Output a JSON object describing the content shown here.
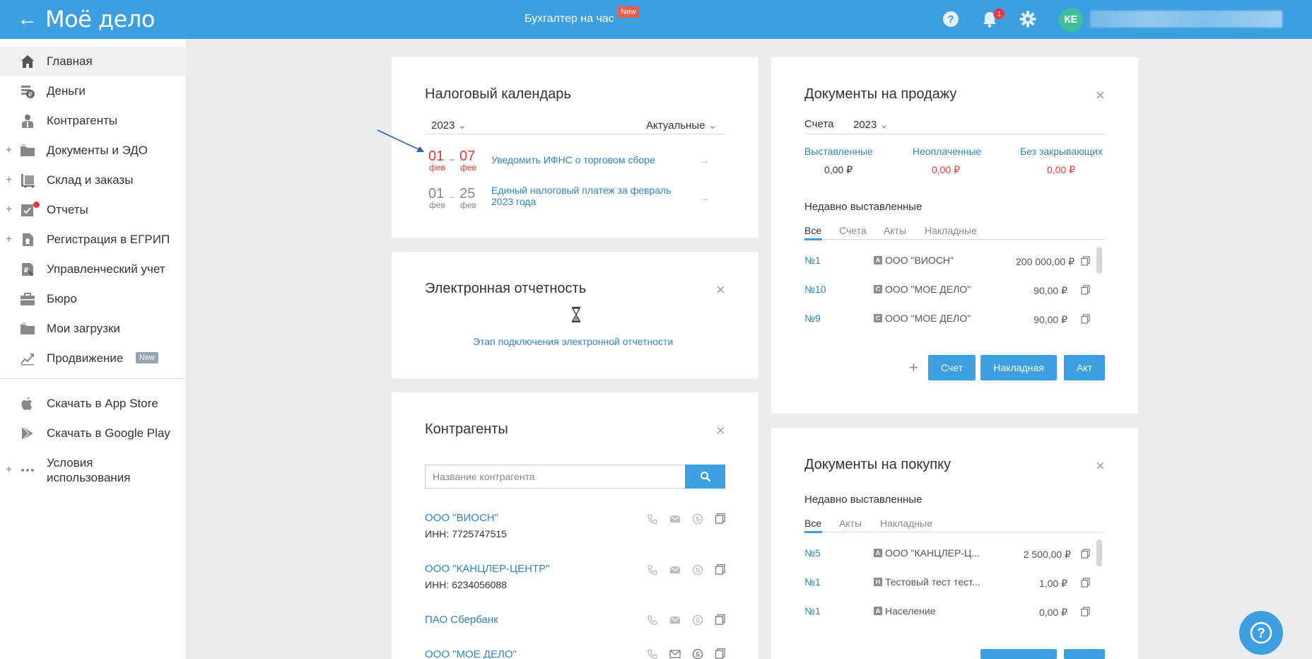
{
  "header": {
    "logo": "Моё дело",
    "center_title": "Бухгалтер на час",
    "center_badge": "New",
    "notification_count": "1",
    "avatar_initials": "КЕ"
  },
  "sidebar": {
    "items": [
      {
        "label": "Главная",
        "icon": "home-icon"
      },
      {
        "label": "Деньги",
        "icon": "money-icon"
      },
      {
        "label": "Контрагенты",
        "icon": "contractors-icon"
      },
      {
        "label": "Документы и ЭДО",
        "icon": "folder-icon"
      },
      {
        "label": "Склад и заказы",
        "icon": "warehouse-icon"
      },
      {
        "label": "Отчеты",
        "icon": "reports-icon"
      },
      {
        "label": "Регистрация в ЕГРИП",
        "icon": "registration-icon"
      },
      {
        "label": "Управленческий учет",
        "icon": "management-icon"
      },
      {
        "label": "Бюро",
        "icon": "briefcase-icon"
      },
      {
        "label": "Мои загрузки",
        "icon": "folder-icon"
      },
      {
        "label": "Продвижение",
        "icon": "chart-icon",
        "badge": "New"
      }
    ],
    "bottom": [
      {
        "label": "Скачать в App Store",
        "icon": "apple-icon"
      },
      {
        "label": "Скачать в Google Play",
        "icon": "google-play-icon"
      },
      {
        "label_line1": "Условия",
        "label_line2": "использования",
        "icon": "more-icon"
      }
    ]
  },
  "tax_calendar": {
    "title": "Налоговый календарь",
    "year": "2023",
    "filter": "Актуальные",
    "rows": [
      {
        "from_day": "01",
        "from_month": "фев",
        "to_day": "07",
        "to_month": "фев",
        "text": "Уведомить ИФНС о торговом сборе"
      },
      {
        "from_day": "01",
        "from_month": "фев",
        "to_day": "25",
        "to_month": "фев",
        "text_line1": "Единый налоговый платеж за февраль",
        "text_line2": "2023 года"
      }
    ]
  },
  "e_reporting": {
    "title": "Электронная отчетность",
    "link": "Этап подключения электронной отчетности"
  },
  "contractors": {
    "title": "Контрагенты",
    "search_placeholder": "Название контрагента",
    "items": [
      {
        "name": "ООО \"ВИОСН\"",
        "inn": "ИНН: 7725747515"
      },
      {
        "name": "ООО \"КАНЦЛЕР-ЦЕНТР\"",
        "inn": "ИНН: 6234056088"
      },
      {
        "name": "ПАО Сбербанк"
      },
      {
        "name": "ООО \"МОЕ ДЕЛО\""
      }
    ]
  },
  "sales_docs": {
    "title": "Документы на продажу",
    "filter_label": "Счета",
    "year": "2023",
    "stats": [
      {
        "label": "Выставленные",
        "value": "0,00 ₽"
      },
      {
        "label": "Неоплаченные",
        "value": "0,00 ₽"
      },
      {
        "label": "Без закрывающих",
        "value": "0,00 ₽"
      }
    ],
    "recent_label": "Недавно выставленные",
    "tabs": [
      "Все",
      "Счета",
      "Акты",
      "Накладные"
    ],
    "rows": [
      {
        "num": "№1",
        "letter": "А",
        "name": "ООО \"ВИОСН\"",
        "sum": "200 000,00 ₽"
      },
      {
        "num": "№10",
        "letter": "С",
        "name": "ООО \"МОЕ ДЕЛО\"",
        "sum": "90,00 ₽"
      },
      {
        "num": "№9",
        "letter": "С",
        "name": "ООО \"МОЕ ДЕЛО\"",
        "sum": "90,00 ₽"
      }
    ],
    "buttons": [
      "Счет",
      "Накладная",
      "Акт"
    ]
  },
  "purchase_docs": {
    "title": "Документы на покупку",
    "recent_label": "Недавно выставленные",
    "tabs": [
      "Все",
      "Акты",
      "Накладные"
    ],
    "rows": [
      {
        "num": "№5",
        "letter": "А",
        "name": "ООО \"КАНЦЛЕР-Ц...",
        "sum": "2 500,00 ₽"
      },
      {
        "num": "№1",
        "letter": "Н",
        "name": "Тестовый тест тест...",
        "sum": "1,00 ₽"
      },
      {
        "num": "№1",
        "letter": "А",
        "name": "Население",
        "sum": "0,00 ₽"
      }
    ]
  },
  "colors": {
    "brand": "#3d9ee0",
    "link": "#2e83c6",
    "alert": "#e53935"
  }
}
